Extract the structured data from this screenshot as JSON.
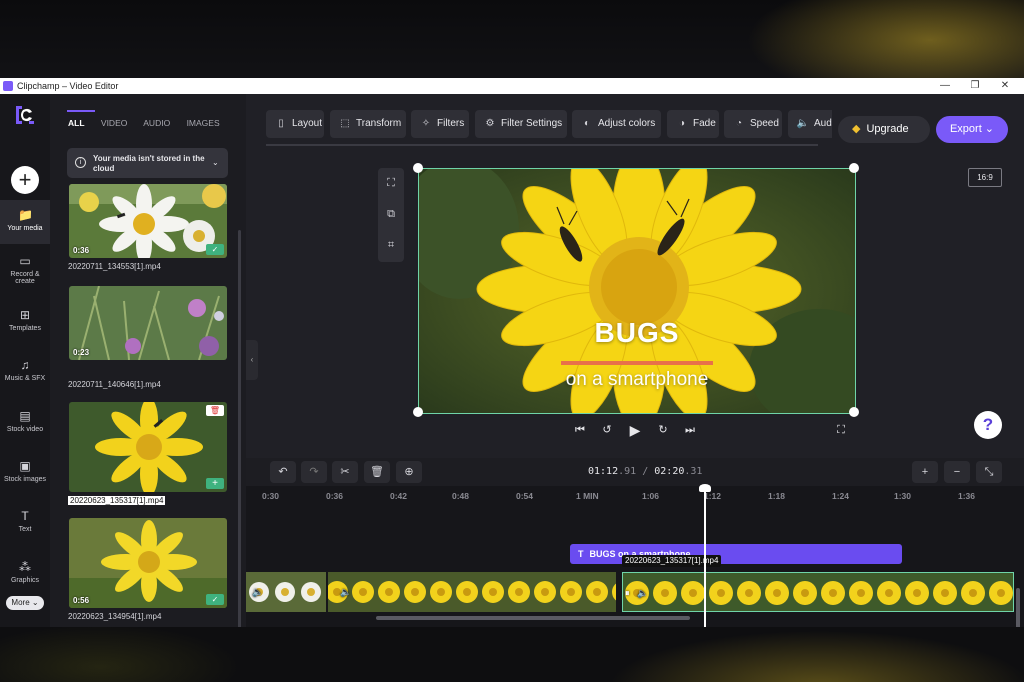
{
  "window": {
    "title": "Clipchamp – Video Editor",
    "min": "—",
    "restore": "❐",
    "close": "✕"
  },
  "rail": {
    "add": "+",
    "items": [
      {
        "label": "Your media",
        "icon": "📁"
      },
      {
        "label": "Record & create",
        "icon": "▭"
      },
      {
        "label": "Templates",
        "icon": "⊞"
      },
      {
        "label": "Music & SFX",
        "icon": "♫"
      },
      {
        "label": "Stock video",
        "icon": "▤"
      },
      {
        "label": "Stock images",
        "icon": "▣"
      },
      {
        "label": "Text",
        "icon": "T"
      },
      {
        "label": "Graphics",
        "icon": "⁂"
      }
    ],
    "more": "More ⌄"
  },
  "media": {
    "tabs": [
      "ALL",
      "VIDEO",
      "AUDIO",
      "IMAGES"
    ],
    "notice": "Your media isn't stored in the cloud",
    "items": [
      {
        "name": "20220711_134553[1].mp4",
        "duration": "0:36"
      },
      {
        "name": "20220711_140646[1].mp4",
        "duration": "0:23"
      },
      {
        "name": "20220623_135317[1].mp4",
        "duration": ""
      },
      {
        "name": "20220623_134954[1].mp4",
        "duration": "0:56"
      }
    ]
  },
  "toolbar": {
    "items": [
      {
        "label": "Layout",
        "icon": "▯"
      },
      {
        "label": "Transform",
        "icon": "⬚"
      },
      {
        "label": "Filters",
        "icon": "✧"
      },
      {
        "label": "Filter Settings",
        "icon": "⚙"
      },
      {
        "label": "Adjust colors",
        "icon": "◐"
      },
      {
        "label": "Fade",
        "icon": "◑"
      },
      {
        "label": "Speed",
        "icon": "◔"
      },
      {
        "label": "Aud",
        "icon": "🔈"
      }
    ],
    "upgrade": "Upgrade",
    "export": "Export ⌄"
  },
  "preview": {
    "ratio": "16:9",
    "title": "BUGS",
    "subtitle": "on a smartphone",
    "help": "?"
  },
  "timeline": {
    "time_current": "01:12",
    "time_current_frac": ".91",
    "sep": "/",
    "time_total": "02:20",
    "time_total_frac": ".31",
    "ticks": [
      "0:30",
      "0:36",
      "0:42",
      "0:48",
      "0:54",
      "1 MIN",
      "1:06",
      "1:12",
      "1:18",
      "1:24",
      "1:30",
      "1:36"
    ],
    "text_clip": "BUGS on a smartphone",
    "selected_clip": "20220623_135317[1].mp4"
  }
}
